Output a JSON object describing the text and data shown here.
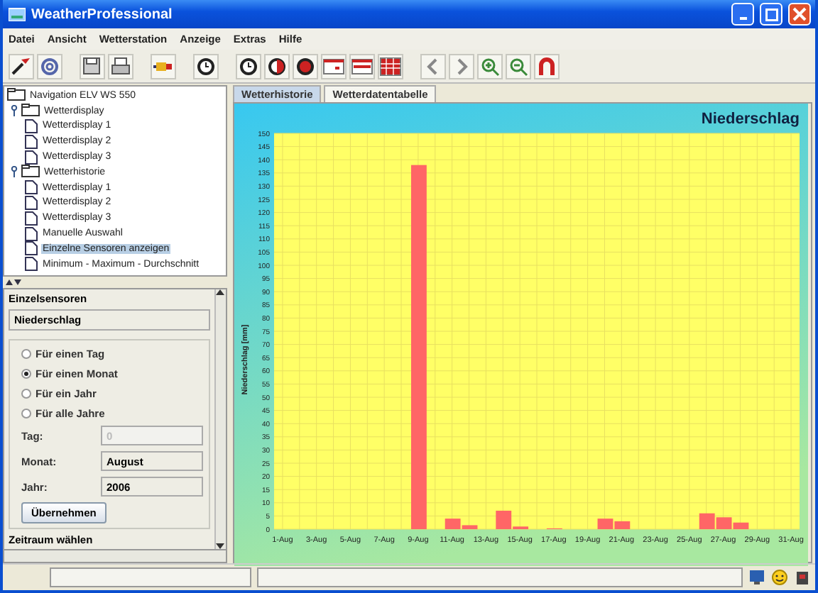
{
  "window": {
    "title": "WeatherProfessional"
  },
  "menu": [
    "Datei",
    "Ansicht",
    "Wetterstation",
    "Anzeige",
    "Extras",
    "Hilfe"
  ],
  "tree": {
    "label": "Navigation ELV WS 550",
    "children": [
      {
        "label": "Wetterdisplay",
        "expanded": true,
        "selected": false,
        "children": [
          {
            "label": "Wetterdisplay 1",
            "selected": false
          },
          {
            "label": "Wetterdisplay 2",
            "selected": false
          },
          {
            "label": "Wetterdisplay 3",
            "selected": false
          }
        ]
      },
      {
        "label": "Wetterhistorie",
        "expanded": true,
        "selected": false,
        "children": [
          {
            "label": "Wetterdisplay 1",
            "selected": false
          },
          {
            "label": "Wetterdisplay 2",
            "selected": false
          },
          {
            "label": "Wetterdisplay 3",
            "selected": false
          },
          {
            "label": "Manuelle Auswahl",
            "selected": false
          },
          {
            "label": "Einzelne Sensoren anzeigen",
            "selected": true
          },
          {
            "label": "Minimum - Maximum - Durchschnitt",
            "selected": false
          }
        ]
      }
    ]
  },
  "sensor_panel": {
    "title": "Einzelsensoren",
    "sensor": "Niederschlag",
    "periods": [
      {
        "label": "Für einen Tag",
        "selected": false
      },
      {
        "label": "Für einen Monat",
        "selected": true
      },
      {
        "label": "Für ein Jahr",
        "selected": false
      },
      {
        "label": "Für alle Jahre",
        "selected": false
      }
    ],
    "fields": [
      {
        "label": "Tag:",
        "value": "0",
        "disabled": true
      },
      {
        "label": "Monat:",
        "value": "August",
        "disabled": false
      },
      {
        "label": "Jahr:",
        "value": "2006",
        "disabled": false
      }
    ],
    "button": "Übernehmen",
    "next_section": "Zeitraum wählen"
  },
  "tabs": [
    {
      "label": "Wetterhistorie",
      "selected": true
    },
    {
      "label": "Wetterdatentabelle",
      "selected": false
    }
  ],
  "chart": {
    "chart_data": {
      "type": "bar",
      "title": "Niederschlag",
      "ylabel": "Niederschlag [mm]",
      "categories": [
        "1-Aug",
        null,
        "3-Aug",
        null,
        "5-Aug",
        null,
        "7-Aug",
        null,
        "9-Aug",
        null,
        "11-Aug",
        null,
        "13-Aug",
        null,
        "15-Aug",
        null,
        "17-Aug",
        null,
        "19-Aug",
        null,
        "21-Aug",
        null,
        "23-Aug",
        null,
        "25-Aug",
        null,
        "27-Aug",
        null,
        "29-Aug",
        null,
        "31-Aug"
      ],
      "series": [
        {
          "color": "#ff6666",
          "values": [
            0,
            0,
            0,
            0,
            0,
            0,
            0,
            0,
            138,
            0,
            4,
            1.5,
            0,
            7,
            1,
            0,
            0.3,
            0,
            0,
            4,
            3,
            0,
            0,
            0,
            0,
            6,
            4.5,
            2.5,
            0,
            0,
            0
          ]
        }
      ],
      "ylim": [
        0,
        150
      ],
      "grid": true,
      "yticks": [
        0,
        5,
        10,
        15,
        20,
        25,
        30,
        35,
        40,
        45,
        50,
        55,
        60,
        65,
        70,
        75,
        80,
        85,
        90,
        95,
        100,
        105,
        110,
        115,
        120,
        125,
        130,
        135,
        140,
        145,
        150
      ]
    }
  }
}
